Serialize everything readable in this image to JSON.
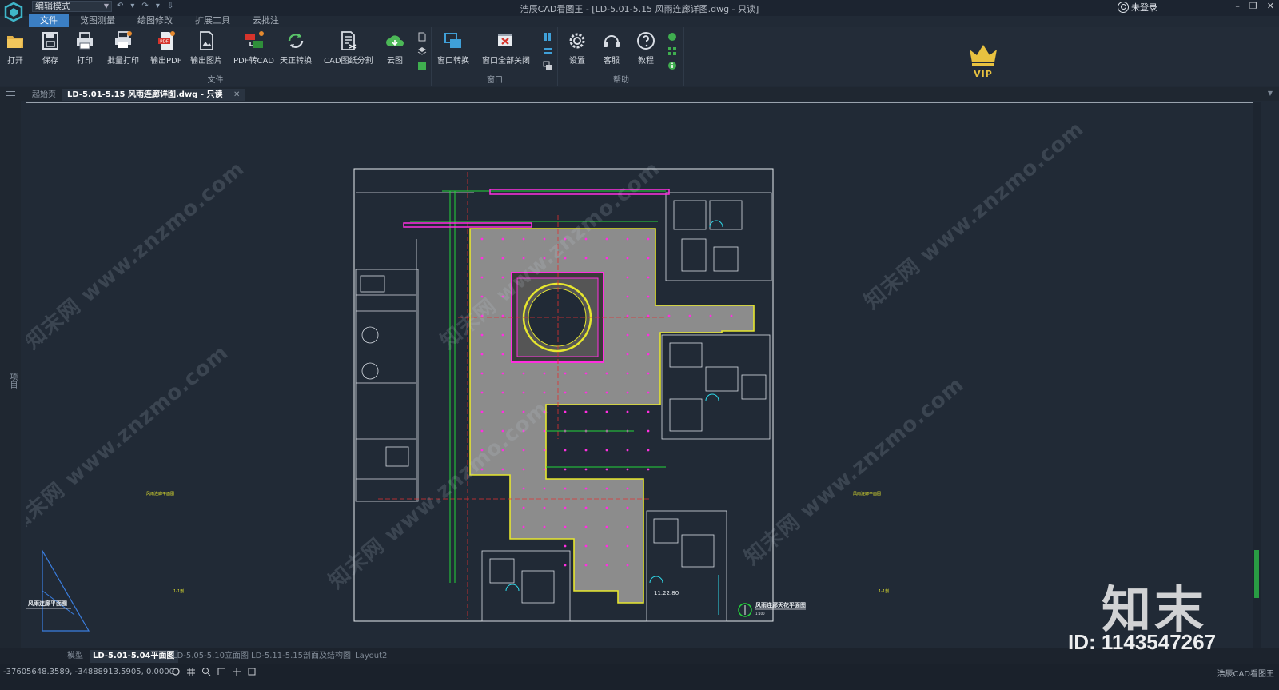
{
  "app": {
    "mode_select": "编辑模式",
    "title": "浩辰CAD看图王 - [LD-5.01-5.15 风雨连廊详图.dwg - 只读]",
    "login_label": "未登录",
    "window_controls": [
      "–",
      "❐",
      "✕"
    ],
    "quick_tools": [
      "↶",
      "▾",
      "↷",
      "▾",
      "⇩"
    ]
  },
  "menu": {
    "tabs": [
      {
        "label": "文件",
        "active": true
      },
      {
        "label": "览图测量",
        "active": false
      },
      {
        "label": "绘图修改",
        "active": false
      },
      {
        "label": "扩展工具",
        "active": false
      },
      {
        "label": "云批注",
        "active": false
      }
    ]
  },
  "ribbon": {
    "file_group": {
      "label": "文件",
      "buttons": [
        {
          "label": "打开",
          "icon": "folder-icon"
        },
        {
          "label": "保存",
          "icon": "save-icon"
        },
        {
          "label": "打印",
          "icon": "print-icon"
        },
        {
          "label": "批量打印",
          "icon": "batch-print-icon"
        },
        {
          "label": "输出PDF",
          "icon": "pdf-export-icon"
        },
        {
          "label": "输出图片",
          "icon": "image-export-icon"
        },
        {
          "label": "PDF转CAD",
          "icon": "pdf-to-cad-icon"
        },
        {
          "label": "天正转换",
          "icon": "tangent-convert-icon"
        },
        {
          "label": "CAD图纸分割",
          "icon": "split-drawing-icon"
        },
        {
          "label": "云图",
          "icon": "cloud-icon"
        }
      ]
    },
    "window_group": {
      "label": "窗口",
      "buttons": [
        {
          "label": "窗口转换",
          "icon": "window-switch-icon"
        },
        {
          "label": "窗口全部关闭",
          "icon": "close-all-icon"
        }
      ]
    },
    "help_group": {
      "label": "帮助",
      "buttons": [
        {
          "label": "设置",
          "icon": "gear-icon"
        },
        {
          "label": "客服",
          "icon": "headset-icon"
        },
        {
          "label": "教程",
          "icon": "question-icon"
        }
      ]
    },
    "vip_label": "VIP"
  },
  "doc_tabs": {
    "start": "起始页",
    "active": "LD-5.01-5.15 风雨连廊详图.dwg - 只读",
    "close": "✕"
  },
  "left_panel": {
    "label": "项目"
  },
  "layout_tabs": [
    {
      "label": "模型",
      "active": false
    },
    {
      "label": "LD-5.01-5.04平面图",
      "active": true
    },
    {
      "label": "LD-5.05-5.10立面图",
      "active": false
    },
    {
      "label": "LD-5.11-5.15剖面及结构图",
      "active": false
    },
    {
      "label": "Layout2",
      "active": false
    }
  ],
  "status": {
    "coords": "-37605648.3589, -34888913.5905, 0.0000",
    "brand": "浩辰CAD看图王"
  },
  "drawing": {
    "plan_title": "风雨连廊天花平面图",
    "left_title": "风雨连廊平面图",
    "scale_note": "1:100",
    "small_labels": [
      "风雨连廊平面图",
      "风雨连廊平面图",
      "1-1剖",
      "1-1剖"
    ],
    "center_level": "11.22.80"
  },
  "watermarks": {
    "site": "知末网 www.znzmo.com",
    "brand": "知末",
    "id": "ID: 1143547267"
  },
  "colors": {
    "accent": "#3b7fc4",
    "canvas": "#212a36",
    "cad_floor": "#8c8c8c",
    "cad_yellow": "#e6e62e",
    "cad_magenta": "#ff2fe0",
    "cad_green": "#22d63a",
    "cad_red": "#e23030"
  }
}
